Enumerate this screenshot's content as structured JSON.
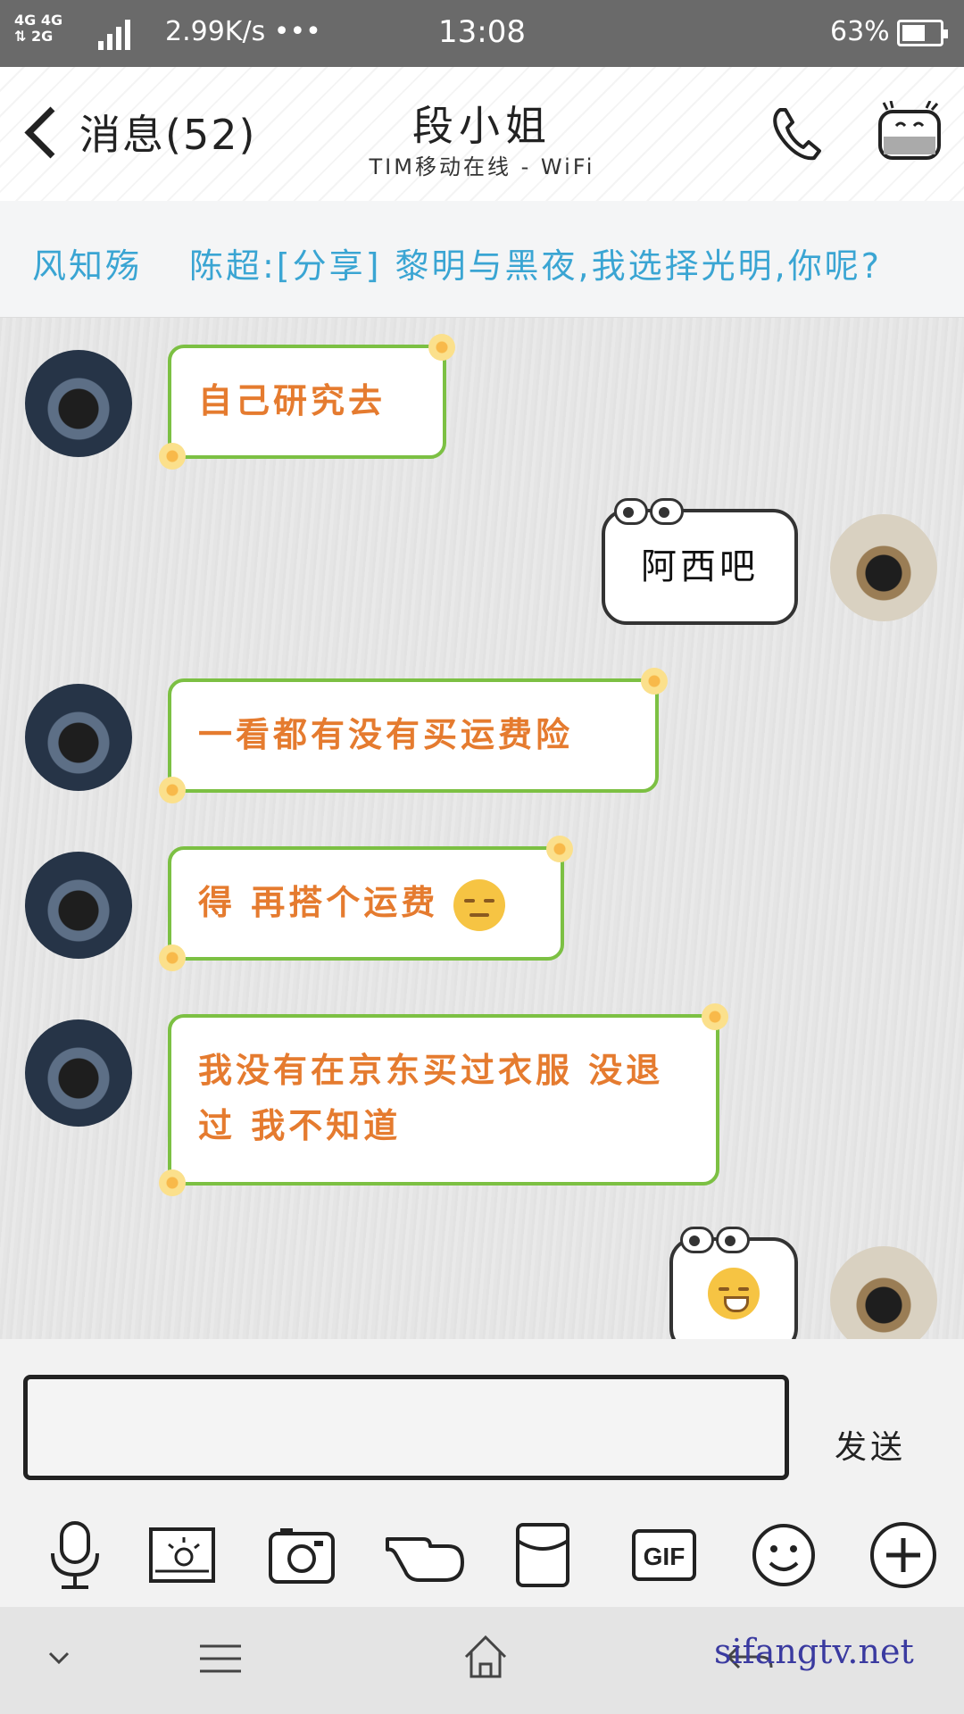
{
  "status_bar": {
    "signal": "4G 4G \n⇅ 2G",
    "network_2g": "2G",
    "speed": "2.99K/s •••",
    "time": "13:08",
    "battery_percent": "63%",
    "battery_level": 0.63
  },
  "header": {
    "back_label": "消息(52)",
    "title": "段小姐",
    "subtitle": "TIM移动在线 - WiFi"
  },
  "notice": {
    "group": "风知殇",
    "message": "陈超:[分享] 黎明与黑夜,我选择光明,你呢?"
  },
  "messages": [
    {
      "side": "in",
      "text": "自己研究去"
    },
    {
      "side": "out",
      "text": "阿西吧"
    },
    {
      "side": "in",
      "text": "一看都有没有买运费险"
    },
    {
      "side": "in",
      "text": "得 再搭个运费",
      "emoji": "pensive-face-emoji"
    },
    {
      "side": "in",
      "text": "我没有在京东买过衣服 没退过 我不知道"
    },
    {
      "side": "out",
      "text": "",
      "emoji": "grinning-face-emoji"
    }
  ],
  "input": {
    "value": "",
    "send_label": "发送"
  },
  "toolbar": [
    {
      "icon": "microphone-icon"
    },
    {
      "icon": "image-icon"
    },
    {
      "icon": "camera-icon"
    },
    {
      "icon": "poke-hand-icon"
    },
    {
      "icon": "red-packet-icon"
    },
    {
      "icon": "gif-icon",
      "label": "GIF"
    },
    {
      "icon": "emoji-icon"
    },
    {
      "icon": "plus-icon"
    }
  ],
  "nav": {
    "watermark": "sifangtv.net"
  },
  "colors": {
    "status_bar": "#6a6a6a",
    "notice_text": "#3aa5d3",
    "incoming_text": "#e57b2f",
    "incoming_border": "#7cc043"
  }
}
